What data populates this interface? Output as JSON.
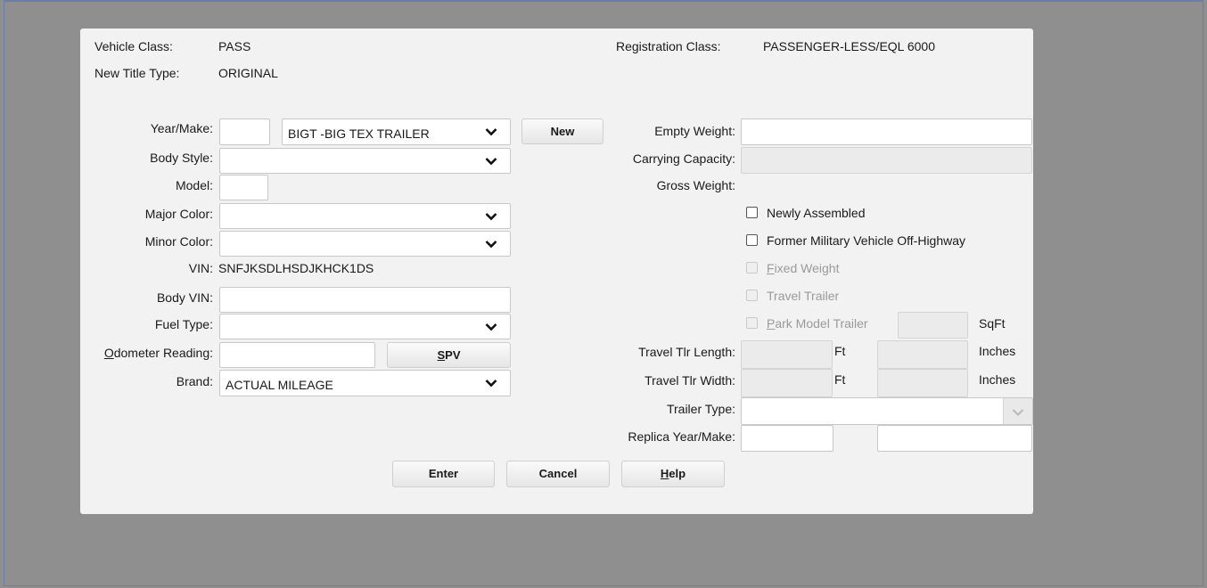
{
  "header": {
    "vehicle_class_label": "Vehicle Class:",
    "vehicle_class_value": "PASS",
    "new_title_type_label": "New Title Type:",
    "new_title_type_value": "ORIGINAL",
    "registration_class_label": "Registration Class:",
    "registration_class_value": "PASSENGER-LESS/EQL 6000"
  },
  "left": {
    "year_make_label": "Year/Make:",
    "year_value": "",
    "make_value": "BIGT -BIG TEX TRAILER",
    "new_button": "New",
    "body_style_label": "Body Style:",
    "body_style_value": "",
    "model_label": "Model:",
    "model_value": "",
    "major_color_label": "Major Color:",
    "major_color_value": "",
    "minor_color_label": "Minor Color:",
    "minor_color_value": "",
    "vin_label": "VIN:",
    "vin_value": "SNFJKSDLHSDJKHCK1DS",
    "body_vin_label": "Body VIN:",
    "body_vin_value": "",
    "fuel_type_label": "Fuel Type:",
    "fuel_type_value": "",
    "odometer_label_first": "O",
    "odometer_label_rest": "dometer Reading:",
    "odometer_value": "",
    "spv_button_first": "S",
    "spv_button_rest": "PV",
    "brand_label": "Brand:",
    "brand_value": "ACTUAL MILEAGE"
  },
  "right": {
    "empty_weight_label": "Empty Weight:",
    "empty_weight_value": "",
    "carrying_capacity_label": "Carrying Capacity:",
    "carrying_capacity_value": "",
    "gross_weight_label": "Gross Weight:",
    "newly_assembled_label": "Newly Assembled",
    "former_military_label": "Former Military Vehicle Off-Highway",
    "fixed_weight_first": "F",
    "fixed_weight_rest": "ixed Weight",
    "travel_trailer_label": "Travel Trailer",
    "park_model_first": "P",
    "park_model_rest": "ark Model Trailer",
    "sqft_unit": "SqFt",
    "travel_tlr_length_label": "Travel Tlr Length:",
    "travel_tlr_width_label": "Travel Tlr Width:",
    "ft_unit": "Ft",
    "inches_unit": "Inches",
    "trailer_type_label": "Trailer Type:",
    "trailer_type_value": "",
    "replica_year_make_label": "Replica Year/Make:",
    "replica_year_value": "",
    "replica_make_value": ""
  },
  "footer": {
    "enter_button": "Enter",
    "cancel_button": "Cancel",
    "help_button_first": "H",
    "help_button_rest": "elp"
  },
  "icons": {
    "dropdown": "chevron-down-icon"
  },
  "colors": {
    "background": "#8f8f8f",
    "panel": "#f2f2f2",
    "disabled_field": "#ebebeb",
    "disabled_text": "#9a9a9a"
  }
}
